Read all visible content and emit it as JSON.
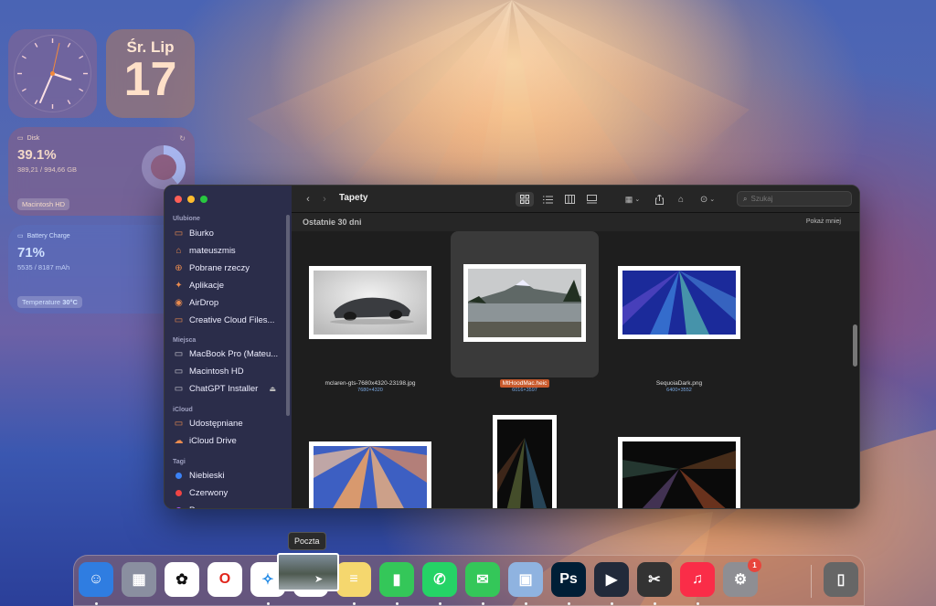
{
  "widgets": {
    "date": {
      "weekday": "Śr. Lip",
      "day": "17"
    },
    "disk": {
      "label": "Disk",
      "percent": "39.1%",
      "detail": "389,21 / 994,66 GB",
      "volume": "Macintosh HD",
      "fill": 0.391
    },
    "battery": {
      "label": "Battery Charge",
      "percent": "71%",
      "detail": "5535 / 8187 mAh",
      "temp_label": "Temperature",
      "temp_value": "30°C"
    }
  },
  "finder": {
    "title": "Tapety",
    "search_placeholder": "Szukaj",
    "group_title": "Ostatnie 30 dni",
    "group_toggle": "Pokaż mniej",
    "sidebar": {
      "favorites_header": "Ulubione",
      "favorites": [
        {
          "label": "Biurko",
          "icon": "desktop-folder-icon"
        },
        {
          "label": "mateuszmis",
          "icon": "home-icon"
        },
        {
          "label": "Pobrane rzeczy",
          "icon": "download-icon"
        },
        {
          "label": "Aplikacje",
          "icon": "applications-icon"
        },
        {
          "label": "AirDrop",
          "icon": "airdrop-icon"
        },
        {
          "label": "Creative Cloud Files...",
          "icon": "folder-icon"
        }
      ],
      "locations_header": "Miejsca",
      "locations": [
        {
          "label": "MacBook Pro (Mateu...",
          "icon": "laptop-icon"
        },
        {
          "label": "Macintosh HD",
          "icon": "disk-icon"
        },
        {
          "label": "ChatGPT Installer",
          "icon": "disk-icon"
        }
      ],
      "icloud_header": "iCloud",
      "icloud": [
        {
          "label": "Udostępniane",
          "icon": "shared-folder-icon"
        },
        {
          "label": "iCloud Drive",
          "icon": "cloud-icon"
        }
      ],
      "tags_header": "Tagi",
      "tags": [
        {
          "label": "Niebieski",
          "color": "#3b82f6"
        },
        {
          "label": "Czerwony",
          "color": "#ef4444"
        },
        {
          "label": "Purpurowy",
          "color": "#a855f7"
        }
      ]
    },
    "files": [
      {
        "name": "mclaren-gts-7680x4320-23198.jpg",
        "dims": "7680×4320"
      },
      {
        "name": "MtHoodMac.heic",
        "dims": "6016×3597",
        "selected": true
      },
      {
        "name": "SequoiaDark.png",
        "dims": "6400×3552"
      }
    ]
  },
  "tooltip": "Poczta",
  "dock": {
    "apps": [
      {
        "name": "Finder",
        "color": "#2f7de1"
      },
      {
        "name": "Launchpad",
        "color": "#8a8fa0"
      },
      {
        "name": "ChatGPT",
        "color": "#ffffff"
      },
      {
        "name": "Opera",
        "color": "#ffffff"
      },
      {
        "name": "Safari",
        "color": "#ffffff"
      },
      {
        "name": "Przypomnienia",
        "color": "#ffffff"
      },
      {
        "name": "Notatki",
        "color": "#f5d76e"
      },
      {
        "name": "Numbers",
        "color": "#34c759"
      },
      {
        "name": "WhatsApp",
        "color": "#25d366"
      },
      {
        "name": "Wiadomości",
        "color": "#34c759"
      },
      {
        "name": "Podgląd",
        "color": "#8fb3e0"
      },
      {
        "name": "Photoshop",
        "color": "#001e36",
        "text": "Ps"
      },
      {
        "name": "Infuse",
        "color": "#222a3a"
      },
      {
        "name": "Final Cut Pro",
        "color": "#333"
      },
      {
        "name": "Muzyka",
        "color": "#fa2d48"
      },
      {
        "name": "Ustawienia systemowe",
        "color": "#8e8e93",
        "badge": "1"
      },
      {
        "name": "Kosz",
        "color": "#666"
      }
    ]
  }
}
